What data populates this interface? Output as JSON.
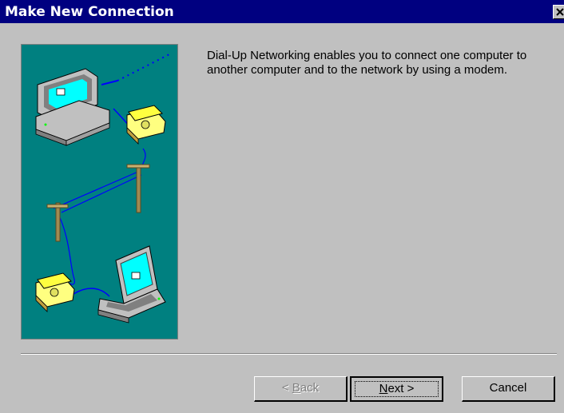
{
  "window": {
    "title": "Make New Connection",
    "close_icon": "close-icon"
  },
  "main": {
    "description": "Dial-Up Networking enables you to connect one computer to another computer and to the network by using a modem."
  },
  "buttons": {
    "back": {
      "label": "< Back",
      "mnemonic": "B",
      "enabled": false
    },
    "next": {
      "label": "Next >",
      "mnemonic": "N",
      "enabled": true,
      "default": true
    },
    "cancel": {
      "label": "Cancel",
      "enabled": true
    }
  },
  "colors": {
    "titlebar": "#000080",
    "dialog": "#c0c0c0",
    "illustration_bg": "#008080"
  }
}
